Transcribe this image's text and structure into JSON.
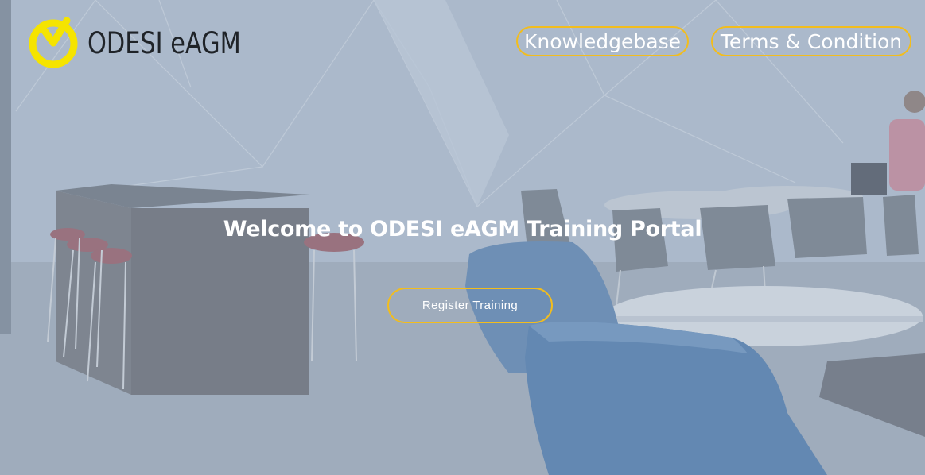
{
  "brand": {
    "name": "ODESI eAGM",
    "accent": "#f2bd1d"
  },
  "nav": [
    {
      "label": "Knowledgebase"
    },
    {
      "label": "Terms & Condition"
    }
  ],
  "hero": {
    "title": "Welcome to ODESI eAGM Training Portal",
    "cta_label": "Register Training"
  }
}
